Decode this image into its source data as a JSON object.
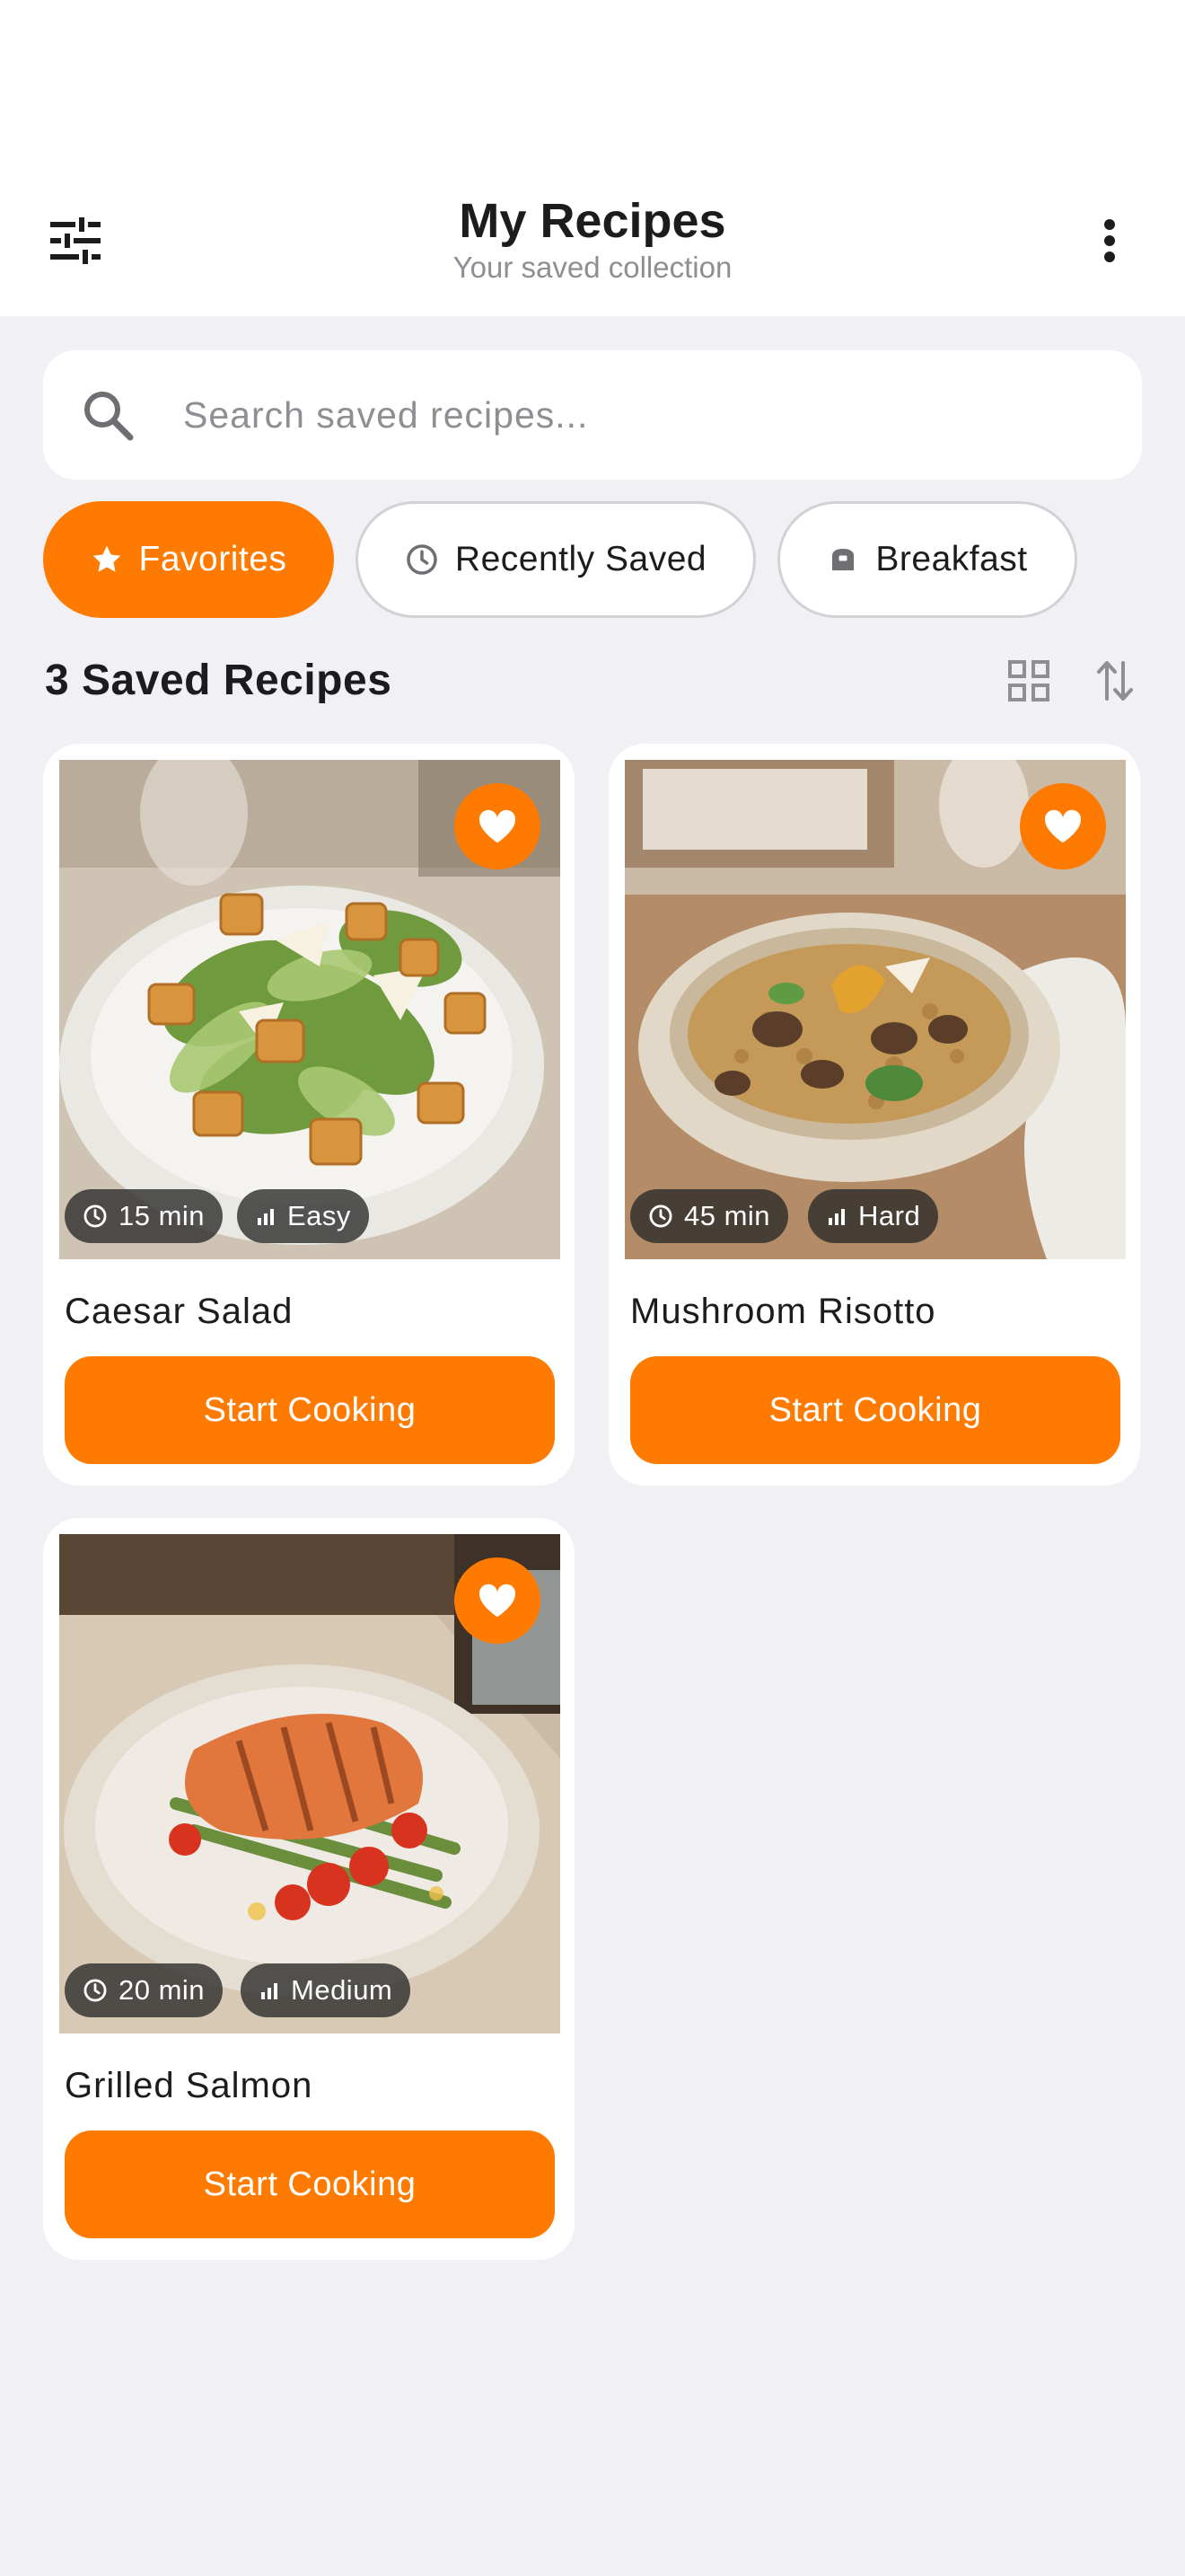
{
  "header": {
    "title": "My Recipes",
    "subtitle": "Your saved collection",
    "left_icon": "sliders-icon",
    "right_icon": "more-vertical-icon"
  },
  "search": {
    "placeholder": "Search saved recipes...",
    "value": "",
    "icon": "search-icon"
  },
  "filters": [
    {
      "label": "Favorites",
      "icon": "star-icon",
      "active": true
    },
    {
      "label": "Recently Saved",
      "icon": "clock-icon",
      "active": false
    },
    {
      "label": "Breakfast",
      "icon": "toaster-icon",
      "active": false
    }
  ],
  "section": {
    "title": "3 Saved Recipes",
    "grid_icon": "grid-view-icon",
    "sort_icon": "sort-icon"
  },
  "recipes": [
    {
      "name": "Caesar Salad",
      "time": "15 min",
      "difficulty": "Easy",
      "favorite": true,
      "action": "Start Cooking"
    },
    {
      "name": "Mushroom Risotto",
      "time": "45 min",
      "difficulty": "Hard",
      "favorite": true,
      "action": "Start Cooking"
    },
    {
      "name": "Grilled Salmon",
      "time": "20 min",
      "difficulty": "Medium",
      "favorite": true,
      "action": "Start Cooking"
    }
  ],
  "colors": {
    "accent": "#ff7a00",
    "background": "#f0f0f5",
    "surface": "#ffffff",
    "text_primary": "#1c1c1e",
    "text_secondary": "#8e8e93"
  }
}
